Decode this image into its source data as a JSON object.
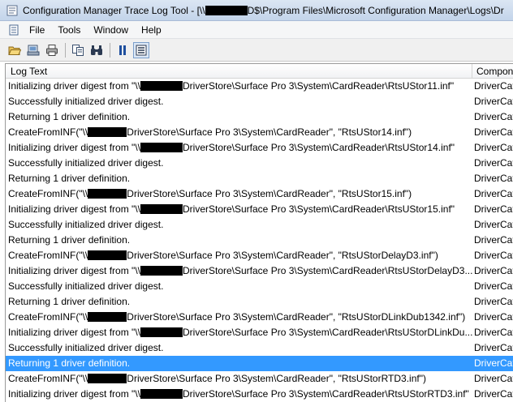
{
  "window": {
    "title": "Configuration Manager Trace Log Tool - [\\\\ ██████ D$\\Program Files\\Microsoft Configuration Manager\\Logs\\Dr",
    "title_prefix": "Configuration Manager Trace Log Tool - [\\\\",
    "title_suffix": "D$\\Program Files\\Microsoft Configuration Manager\\Logs\\Dr"
  },
  "menu": {
    "items": [
      {
        "label": "File"
      },
      {
        "label": "Tools"
      },
      {
        "label": "Window"
      },
      {
        "label": "Help"
      }
    ]
  },
  "toolbar": {
    "icons": [
      "open-folder-icon",
      "print-preview-icon",
      "print-icon",
      "copy-icon",
      "find-icon",
      "pause-icon",
      "filter-list-icon"
    ]
  },
  "colors": {
    "selection": "#3399ff",
    "titlebar": "#c3d4ea"
  },
  "columns": {
    "log_text": "Log Text",
    "component": "Compone"
  },
  "rows": [
    {
      "pre": "Initializing driver digest from \"\\\\",
      "redact": 52,
      "post": "DriverStore\\Surface Pro 3\\System\\CardReader\\RtsUStor11.inf\"",
      "comp": "DriverCat"
    },
    {
      "pre": "Successfully initialized driver digest.",
      "redact": 0,
      "post": "",
      "comp": "DriverCat"
    },
    {
      "pre": "Returning 1 driver definition.",
      "redact": 0,
      "post": "",
      "comp": "DriverCat"
    },
    {
      "pre": "CreateFromINF(\"\\\\",
      "redact": 48,
      "post": "DriverStore\\Surface Pro 3\\System\\CardReader\", \"RtsUStor14.inf\")",
      "comp": "DriverCat"
    },
    {
      "pre": "Initializing driver digest from \"\\\\",
      "redact": 52,
      "post": "DriverStore\\Surface Pro 3\\System\\CardReader\\RtsUStor14.inf\"",
      "comp": "DriverCat"
    },
    {
      "pre": "Successfully initialized driver digest.",
      "redact": 0,
      "post": "",
      "comp": "DriverCat"
    },
    {
      "pre": "Returning 1 driver definition.",
      "redact": 0,
      "post": "",
      "comp": "DriverCat"
    },
    {
      "pre": "CreateFromINF(\"\\\\",
      "redact": 48,
      "post": "DriverStore\\Surface Pro 3\\System\\CardReader\", \"RtsUStor15.inf\")",
      "comp": "DriverCat"
    },
    {
      "pre": "Initializing driver digest from \"\\\\",
      "redact": 52,
      "post": "DriverStore\\Surface Pro 3\\System\\CardReader\\RtsUStor15.inf\"",
      "comp": "DriverCat"
    },
    {
      "pre": "Successfully initialized driver digest.",
      "redact": 0,
      "post": "",
      "comp": "DriverCat"
    },
    {
      "pre": "Returning 1 driver definition.",
      "redact": 0,
      "post": "",
      "comp": "DriverCat"
    },
    {
      "pre": "CreateFromINF(\"\\\\",
      "redact": 48,
      "post": "DriverStore\\Surface Pro 3\\System\\CardReader\", \"RtsUStorDelayD3.inf\")",
      "comp": "DriverCat"
    },
    {
      "pre": "Initializing driver digest from \"\\\\",
      "redact": 52,
      "post": "DriverStore\\Surface Pro 3\\System\\CardReader\\RtsUStorDelayD3....",
      "comp": "DriverCat"
    },
    {
      "pre": "Successfully initialized driver digest.",
      "redact": 0,
      "post": "",
      "comp": "DriverCat"
    },
    {
      "pre": "Returning 1 driver definition.",
      "redact": 0,
      "post": "",
      "comp": "DriverCat"
    },
    {
      "pre": "CreateFromINF(\"\\\\",
      "redact": 48,
      "post": "DriverStore\\Surface Pro 3\\System\\CardReader\", \"RtsUStorDLinkDub1342.inf\")",
      "comp": "DriverCat"
    },
    {
      "pre": "Initializing driver digest from \"\\\\",
      "redact": 52,
      "post": "DriverStore\\Surface Pro 3\\System\\CardReader\\RtsUStorDLinkDu...",
      "comp": "DriverCat"
    },
    {
      "pre": "Successfully initialized driver digest.",
      "redact": 0,
      "post": "",
      "comp": "DriverCat"
    },
    {
      "pre": "Returning 1 driver definition.",
      "redact": 0,
      "post": "",
      "comp": "DriverCat",
      "selected": true
    },
    {
      "pre": "CreateFromINF(\"\\\\",
      "redact": 48,
      "post": "DriverStore\\Surface Pro 3\\System\\CardReader\", \"RtsUStorRTD3.inf\")",
      "comp": "DriverCat"
    },
    {
      "pre": "Initializing driver digest from \"\\\\",
      "redact": 52,
      "post": "DriverStore\\Surface Pro 3\\System\\CardReader\\RtsUStorRTD3.inf\"",
      "comp": "DriverCat"
    }
  ]
}
